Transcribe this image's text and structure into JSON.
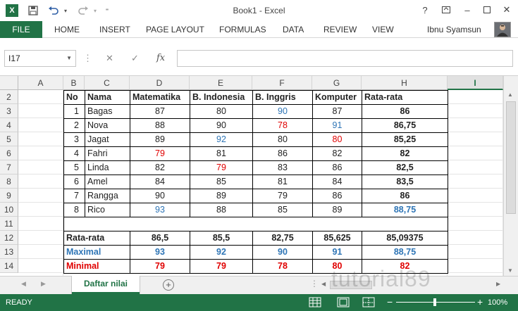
{
  "window": {
    "title": "Book1 - Excel",
    "user": "Ibnu Syamsun"
  },
  "ribbon_tabs": [
    "FILE",
    "HOME",
    "INSERT",
    "PAGE LAYOUT",
    "FORMULAS",
    "DATA",
    "REVIEW",
    "VIEW"
  ],
  "formula_bar": {
    "name_box": "I17",
    "fx_symbol": "fx",
    "formula": ""
  },
  "columns": [
    "A",
    "B",
    "C",
    "D",
    "E",
    "F",
    "G",
    "H",
    "I"
  ],
  "rows": [
    "2",
    "3",
    "4",
    "5",
    "6",
    "7",
    "8",
    "9",
    "10",
    "11",
    "12",
    "13",
    "14"
  ],
  "table": {
    "headers": [
      "No",
      "Nama",
      "Matematika",
      "B. Indonesia",
      "B. Inggris",
      "Komputer",
      "Rata-rata"
    ],
    "rows": [
      [
        "1",
        "Bagas",
        "87",
        "80",
        "90",
        "87",
        "86"
      ],
      [
        "2",
        "Nova",
        "88",
        "90",
        "78",
        "91",
        "86,75"
      ],
      [
        "3",
        "Jagat",
        "89",
        "92",
        "80",
        "80",
        "85,25"
      ],
      [
        "4",
        "Fahri",
        "79",
        "81",
        "86",
        "82",
        "82"
      ],
      [
        "5",
        "Linda",
        "82",
        "79",
        "83",
        "86",
        "82,5"
      ],
      [
        "6",
        "Amel",
        "84",
        "85",
        "81",
        "84",
        "83,5"
      ],
      [
        "7",
        "Rangga",
        "90",
        "89",
        "79",
        "86",
        "86"
      ],
      [
        "8",
        "Rico",
        "93",
        "88",
        "85",
        "89",
        "88,75"
      ]
    ],
    "cell_colors": [
      [
        "",
        "",
        "",
        "",
        "blue",
        "",
        ""
      ],
      [
        "",
        "",
        "",
        "",
        "red",
        "blue",
        ""
      ],
      [
        "",
        "",
        "",
        "blue",
        "",
        "red",
        ""
      ],
      [
        "",
        "",
        "red",
        "",
        "",
        "",
        ""
      ],
      [
        "",
        "",
        "",
        "red",
        "",
        "",
        ""
      ],
      [
        "",
        "",
        "",
        "",
        "",
        "",
        ""
      ],
      [
        "",
        "",
        "",
        "",
        "",
        "",
        ""
      ],
      [
        "",
        "",
        "blue",
        "",
        "",
        "",
        "blue"
      ]
    ],
    "summary": [
      {
        "label": "Rata-rata",
        "values": [
          "86,5",
          "85,5",
          "82,75",
          "85,625",
          "85,09375"
        ],
        "color": ""
      },
      {
        "label": "Maximal",
        "values": [
          "93",
          "92",
          "90",
          "91",
          "88,75"
        ],
        "color": "blue"
      },
      {
        "label": "Minimal",
        "values": [
          "79",
          "79",
          "78",
          "80",
          "82"
        ],
        "color": "red"
      }
    ]
  },
  "sheet_tabs": [
    {
      "label": "Daftar nilai",
      "active": true
    }
  ],
  "status": {
    "ready": "READY",
    "zoom": "100%"
  },
  "watermark": "tutorial89",
  "colors": {
    "excel_green": "#217346",
    "blue": "#2e75b6",
    "red": "#e00000"
  }
}
